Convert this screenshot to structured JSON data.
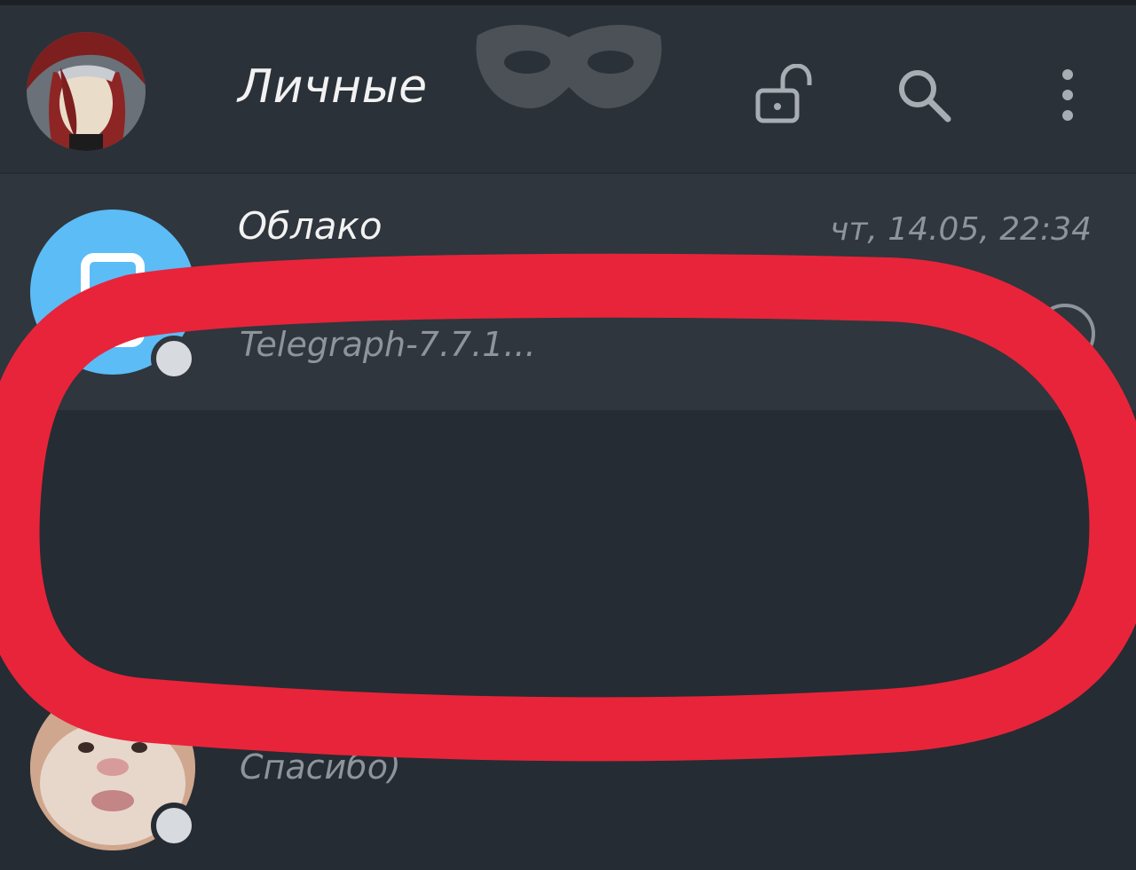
{
  "header": {
    "title": "Личные",
    "avatar_icon": "profile-avatar",
    "mask_icon": "incognito-mask-icon",
    "lock_icon": "unlock-icon",
    "search_icon": "search-icon",
    "menu_icon": "more-vertical-icon"
  },
  "chats": [
    {
      "name": "Облако",
      "time": "чт, 14.05, 22:34",
      "preview": "Telegraph-7.7.1...",
      "avatar_color": "#5cbcf6",
      "status": "read"
    },
    {
      "name": "",
      "time": "",
      "preview": "Спасибо)",
      "avatar_icon": "hamster-avatar"
    }
  ],
  "colors": {
    "background": "#262c33",
    "header": "#2b3138",
    "selected_row": "#2f363d",
    "scribble": "#e8243a"
  }
}
